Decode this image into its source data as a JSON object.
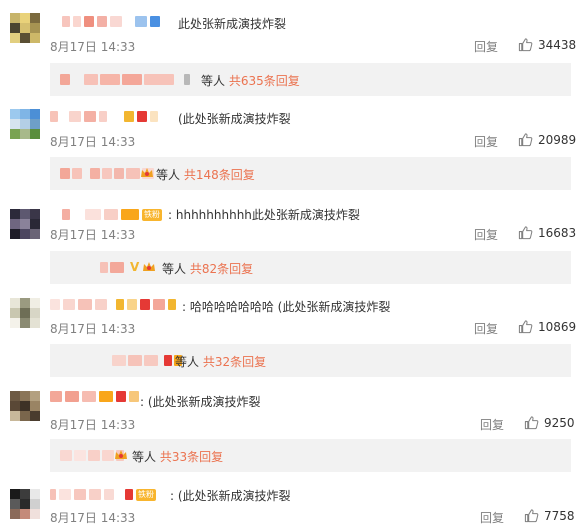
{
  "comments": [
    {
      "text": "此处张新成演技炸裂",
      "time": "8月17日 14:33",
      "reply_label": "回复",
      "likes": "34438",
      "sub": {
        "prefix": "等人",
        "more": "共635条回复"
      }
    },
    {
      "text": "(此处张新成演技炸裂",
      "time": "8月17日 14:33",
      "reply_label": "回复",
      "likes": "20989",
      "sub": {
        "prefix": "等人",
        "more": "共148条回复"
      }
    },
    {
      "text": ": hhhhhhhhhh此处张新成演技炸裂",
      "time": "8月17日 14:33",
      "reply_label": "回复",
      "likes": "16683",
      "sub": {
        "prefix": "等人",
        "more": "共82条回复"
      }
    },
    {
      "text": ": 哈哈哈哈哈哈哈 (此处张新成演技炸裂",
      "time": "8月17日 14:33",
      "reply_label": "回复",
      "likes": "10869",
      "sub": {
        "prefix": "等人",
        "more": "共32条回复"
      }
    },
    {
      "text": ": (此处张新成演技炸裂",
      "time": "8月17日 14:33",
      "reply_label": "回复",
      "likes": "9250",
      "sub": {
        "prefix": "等人",
        "more": "共33条回复"
      }
    },
    {
      "text": ": (此处张新成演技炸裂",
      "time": "8月17日 14:33",
      "reply_label": "回复",
      "likes": "7758",
      "badge": "铁粉"
    }
  ],
  "badges": {
    "fan": "铁粉",
    "v": "V"
  },
  "colors": {
    "link": "#eb7350",
    "time": "#808080",
    "sub_bg": "#f2f2f2",
    "badge": "#f8b52e"
  },
  "icons": {
    "like": "thumbs-up-icon",
    "crown": "crown-icon"
  }
}
